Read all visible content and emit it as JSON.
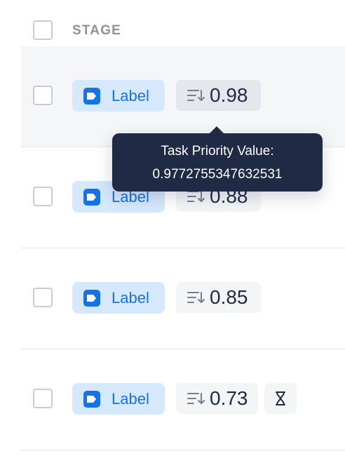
{
  "header": {
    "stage_label": "STAGE"
  },
  "rows": [
    {
      "stage": "Label",
      "priority": "0.98",
      "hovered": true
    },
    {
      "stage": "Label",
      "priority": "0.88"
    },
    {
      "stage": "Label",
      "priority": "0.85"
    },
    {
      "stage": "Label",
      "priority": "0.73",
      "status_icon": "hourglass-icon"
    }
  ],
  "tooltip": {
    "title": "Task Priority Value:",
    "value": "0.9772755347632531"
  },
  "icons": {
    "stage": "label-tag-icon",
    "priority": "sort-priority-icon",
    "status": "hourglass-icon"
  },
  "colors": {
    "accent": "#1673e3",
    "chip_bg": "#d5e8fc",
    "tooltip_bg": "#1f2a44",
    "text_dark": "#1d2b46"
  }
}
